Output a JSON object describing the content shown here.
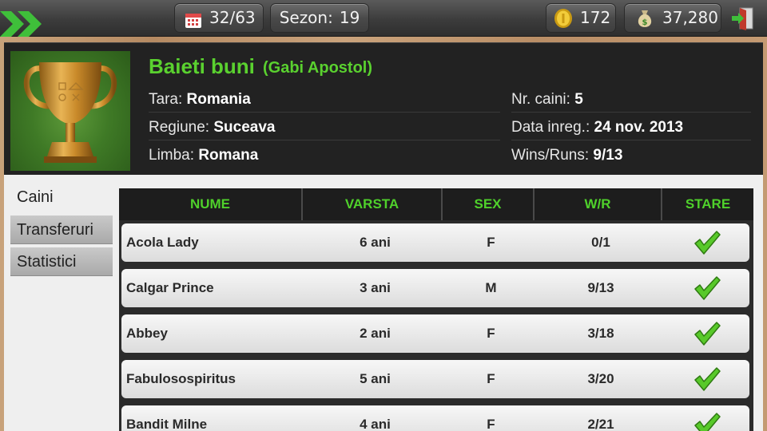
{
  "topbar": {
    "calendar_icon": "calendar-icon",
    "progress": "32/63",
    "season_label": "Sezon:",
    "season_value": "19",
    "coins": "172",
    "money": "37,280",
    "back_icon": "double-chevron-right-icon",
    "exit_icon": "exit-door-icon"
  },
  "team": {
    "name": "Baieti buni",
    "owner": "(Gabi Apostol)",
    "trophy_icon": "gold-trophy-icon",
    "info_left": [
      {
        "label": "Tara:",
        "value": "Romania"
      },
      {
        "label": "Regiune:",
        "value": "Suceava"
      },
      {
        "label": "Limba:",
        "value": "Romana"
      }
    ],
    "info_right": [
      {
        "label": "Nr. caini:",
        "value": "5"
      },
      {
        "label": "Data inreg.:",
        "value": "24 nov. 2013"
      },
      {
        "label": "Wins/Runs:",
        "value": "9/13"
      }
    ]
  },
  "tabs": [
    {
      "label": "Caini",
      "active": true
    },
    {
      "label": "Transferuri",
      "active": false
    },
    {
      "label": "Statistici",
      "active": false
    }
  ],
  "table": {
    "headers": [
      "NUME",
      "VARSTA",
      "SEX",
      "W/R",
      "STARE"
    ],
    "rows": [
      {
        "name": "Acola Lady",
        "age": "6 ani",
        "sex": "F",
        "wr": "0/1",
        "status": "check"
      },
      {
        "name": "Calgar Prince",
        "age": "3 ani",
        "sex": "M",
        "wr": "9/13",
        "status": "check"
      },
      {
        "name": "Abbey",
        "age": "2 ani",
        "sex": "F",
        "wr": "3/18",
        "status": "check"
      },
      {
        "name": "Fabulosospiritus",
        "age": "5 ani",
        "sex": "F",
        "wr": "3/20",
        "status": "check"
      },
      {
        "name": "Bandit Milne",
        "age": "4 ani",
        "sex": "F",
        "wr": "2/21",
        "status": "check"
      }
    ]
  },
  "colors": {
    "accent_green": "#5ad12f",
    "header_green": "#4fd12b",
    "check_green": "#58c92a"
  }
}
